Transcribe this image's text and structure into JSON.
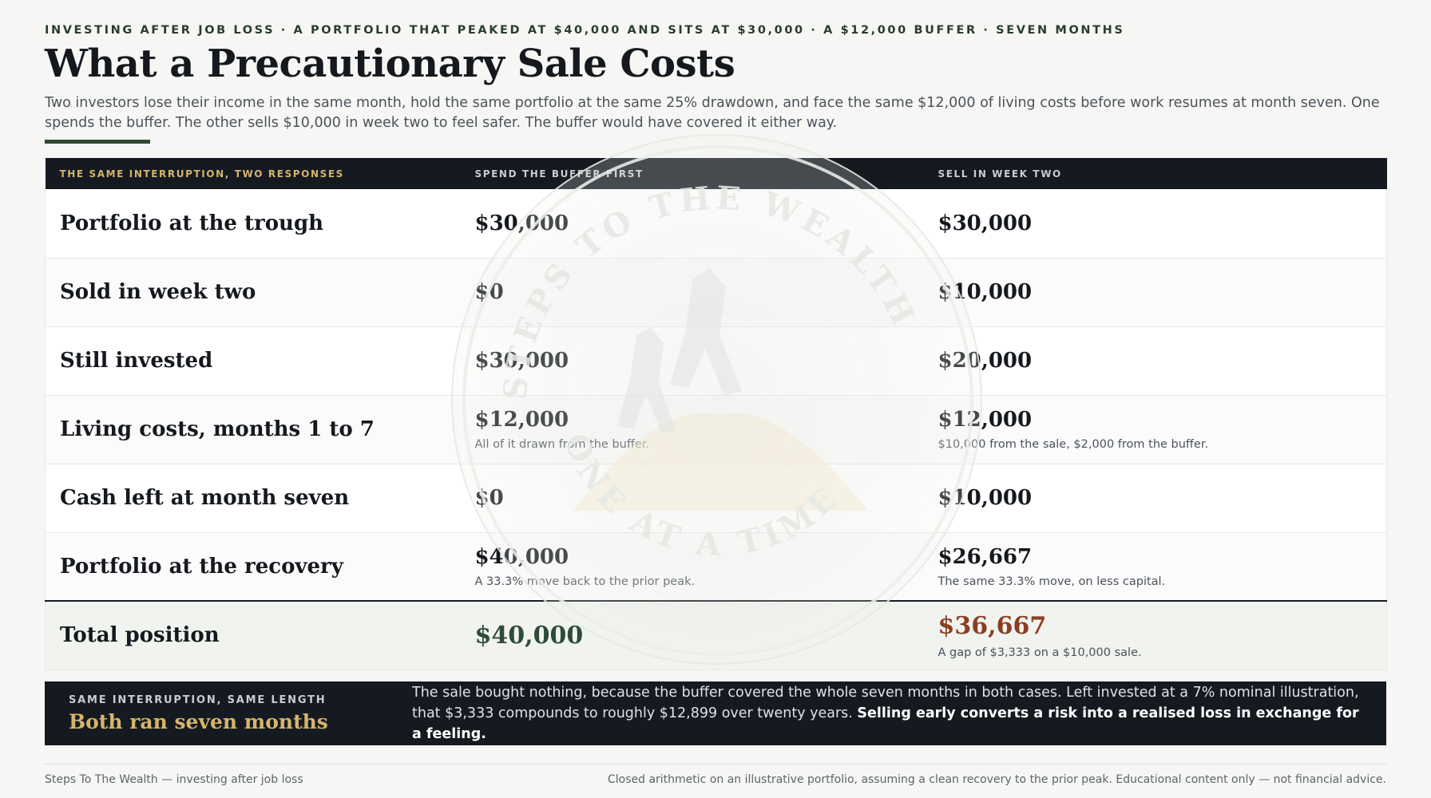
{
  "header": {
    "eyebrow": "INVESTING AFTER JOB LOSS · A PORTFOLIO THAT PEAKED AT $40,000 AND SITS AT $30,000 · A $12,000 BUFFER · SEVEN MONTHS",
    "title": "What a Precautionary Sale Costs",
    "intro": "Two investors lose their income in the same month, hold the same portfolio at the same 25% drawdown, and face the same $12,000 of living costs before work resumes at month seven. One spends the buffer. The other sells $10,000 in week two to feel safer. The buffer would have covered it either way."
  },
  "watermark": {
    "text_top": "STEPS TO THE WEALTH",
    "text_bottom": "ONE AT A TIME"
  },
  "table": {
    "headers": [
      "THE SAME INTERRUPTION, TWO RESPONSES",
      "SPEND THE BUFFER FIRST",
      "SELL IN WEEK TWO"
    ],
    "rows": [
      {
        "label": "Portfolio at the trough",
        "a": "$30,000",
        "a_note": "",
        "b": "$30,000",
        "b_note": ""
      },
      {
        "label": "Sold in week two",
        "a": "$0",
        "a_note": "",
        "b": "$10,000",
        "b_note": ""
      },
      {
        "label": "Still invested",
        "a": "$30,000",
        "a_note": "",
        "b": "$20,000",
        "b_note": ""
      },
      {
        "label": "Living costs, months 1 to 7",
        "a": "$12,000",
        "a_note": "All of it drawn from the buffer.",
        "b": "$12,000",
        "b_note": "$10,000 from the sale, $2,000 from the buffer."
      },
      {
        "label": "Cash left at month seven",
        "a": "$0",
        "a_note": "",
        "b": "$10,000",
        "b_note": ""
      },
      {
        "label": "Portfolio at the recovery",
        "a": "$40,000",
        "a_note": "A 33.3% move back to the prior peak.",
        "b": "$26,667",
        "b_note": "The same 33.3% move, on less capital."
      }
    ],
    "total": {
      "label": "Total position",
      "a": "$40,000",
      "b": "$36,667",
      "b_note": "A gap of $3,333 on a $10,000 sale."
    }
  },
  "callout": {
    "eyebrow": "SAME INTERRUPTION, SAME LENGTH",
    "heading": "Both ran seven months",
    "body": "The sale bought nothing, because the buffer covered the whole seven months in both cases. Left invested at a 7% nominal illustration, that $3,333 compounds to roughly $12,899 over twenty years.",
    "body_bold": "Selling early converts a risk into a realised loss in exchange for a feeling."
  },
  "footer": {
    "left": "Steps To The Wealth — investing after job loss",
    "right": "Closed arithmetic on an illustrative portfolio, assuming a clean recovery to the prior peak. Educational content only — not financial advice."
  },
  "colors": {
    "dark": "#141a20",
    "gold": "#d6b46a",
    "green": "#2e4c35",
    "rust": "#8a3f22"
  }
}
